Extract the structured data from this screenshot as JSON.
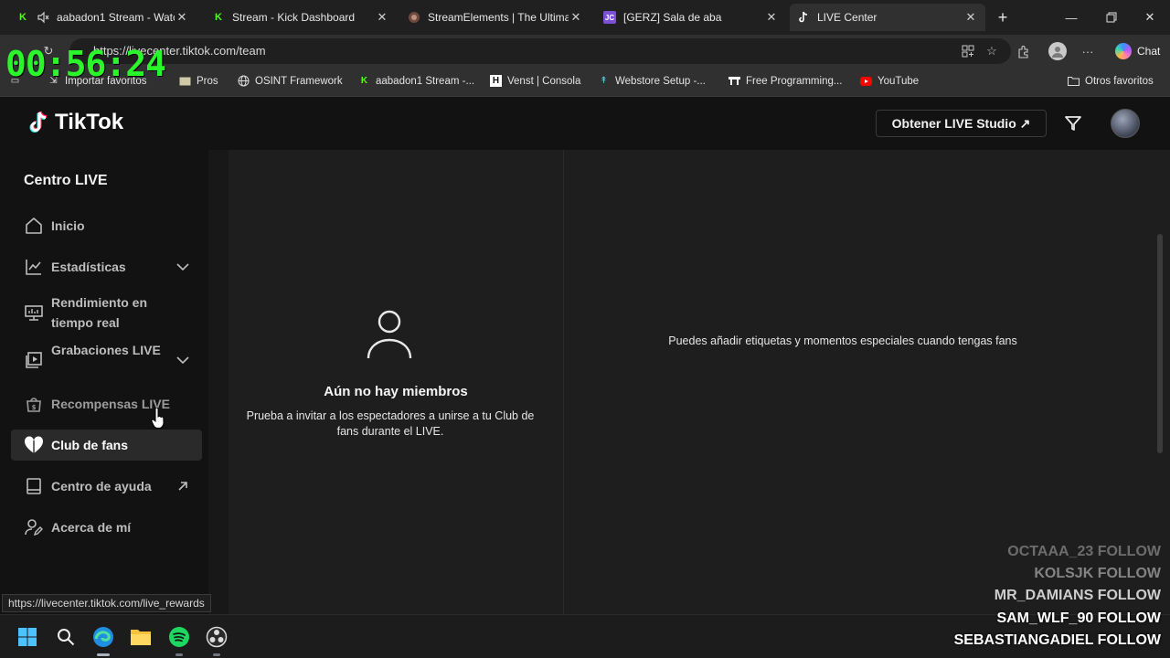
{
  "browser": {
    "tabs": [
      {
        "label": "aabadon1 Stream - Watch L",
        "icon": "kick-icon",
        "muted": true,
        "active": false
      },
      {
        "label": "Stream - Kick Dashboard",
        "icon": "kick-icon",
        "active": false
      },
      {
        "label": "StreamElements | The Ultimate S",
        "icon": "streamelements-icon",
        "active": false
      },
      {
        "label": "[GERZ] Sala de aba",
        "icon": "twitch-icon",
        "active": false
      },
      {
        "label": "LIVE Center",
        "icon": "tiktok-icon",
        "active": true
      }
    ],
    "address": "https://livecenter.tiktok.com/team",
    "chat_label": "Chat",
    "bookmarks": [
      {
        "label": "Importar favoritos",
        "icon": "import-icon"
      },
      {
        "label": "Pros",
        "icon": "folder-icon"
      },
      {
        "label": "OSINT Framework",
        "icon": "globe-icon"
      },
      {
        "label": "aabadon1 Stream -...",
        "icon": "kick-icon"
      },
      {
        "label": "Venst | Consola",
        "icon": "h-icon"
      },
      {
        "label": "Webstore Setup -...",
        "icon": "pin-icon"
      },
      {
        "label": "Free Programming...",
        "icon": "fcc-icon"
      },
      {
        "label": "YouTube",
        "icon": "youtube-icon"
      }
    ],
    "other_bookmarks": "Otros favoritos",
    "status_url": "https://livecenter.tiktok.com/live_rewards"
  },
  "overlay": {
    "timer": "00:56:24",
    "follows": [
      {
        "text": "OCTAAA_23  FOLLOW",
        "opacity": 0.35
      },
      {
        "text": "KOLSJK  FOLLOW",
        "opacity": 0.45
      },
      {
        "text": "MR_DAMIANS  FOLLOW",
        "opacity": 0.75
      },
      {
        "text": "SAM_WLF_90  FOLLOW",
        "opacity": 1
      },
      {
        "text": "SEBASTIANGADIEL  FOLLOW",
        "opacity": 1
      }
    ]
  },
  "tiktok": {
    "logo": "TikTok",
    "live_studio_button": "Obtener LIVE Studio ↗",
    "sidebar_title": "Centro LIVE",
    "nav": [
      {
        "label": "Inicio",
        "icon": "home-icon"
      },
      {
        "label": "Estadísticas",
        "icon": "chart-icon",
        "expandable": true
      },
      {
        "label": "Rendimiento en tiempo real",
        "icon": "monitor-icon"
      },
      {
        "label": "Grabaciones LIVE",
        "icon": "recordings-icon",
        "expandable": true
      },
      {
        "label": "Recompensas LIVE",
        "icon": "rewards-icon"
      },
      {
        "label": "Club de fans",
        "icon": "heart-icon",
        "active": true
      },
      {
        "label": "Centro de ayuda",
        "icon": "book-icon",
        "external": true
      },
      {
        "label": "Acerca de mí",
        "icon": "user-edit-icon"
      }
    ],
    "empty_title": "Aún no hay miembros",
    "empty_desc": "Prueba a invitar a los espectadores a unirse a tu Club de fans durante el LIVE.",
    "right_message": "Puedes añadir etiquetas y momentos especiales cuando tengas fans"
  },
  "colors": {
    "accent_timer": "#2bf52b",
    "background": "#121212",
    "panel": "#1e1e1e"
  }
}
